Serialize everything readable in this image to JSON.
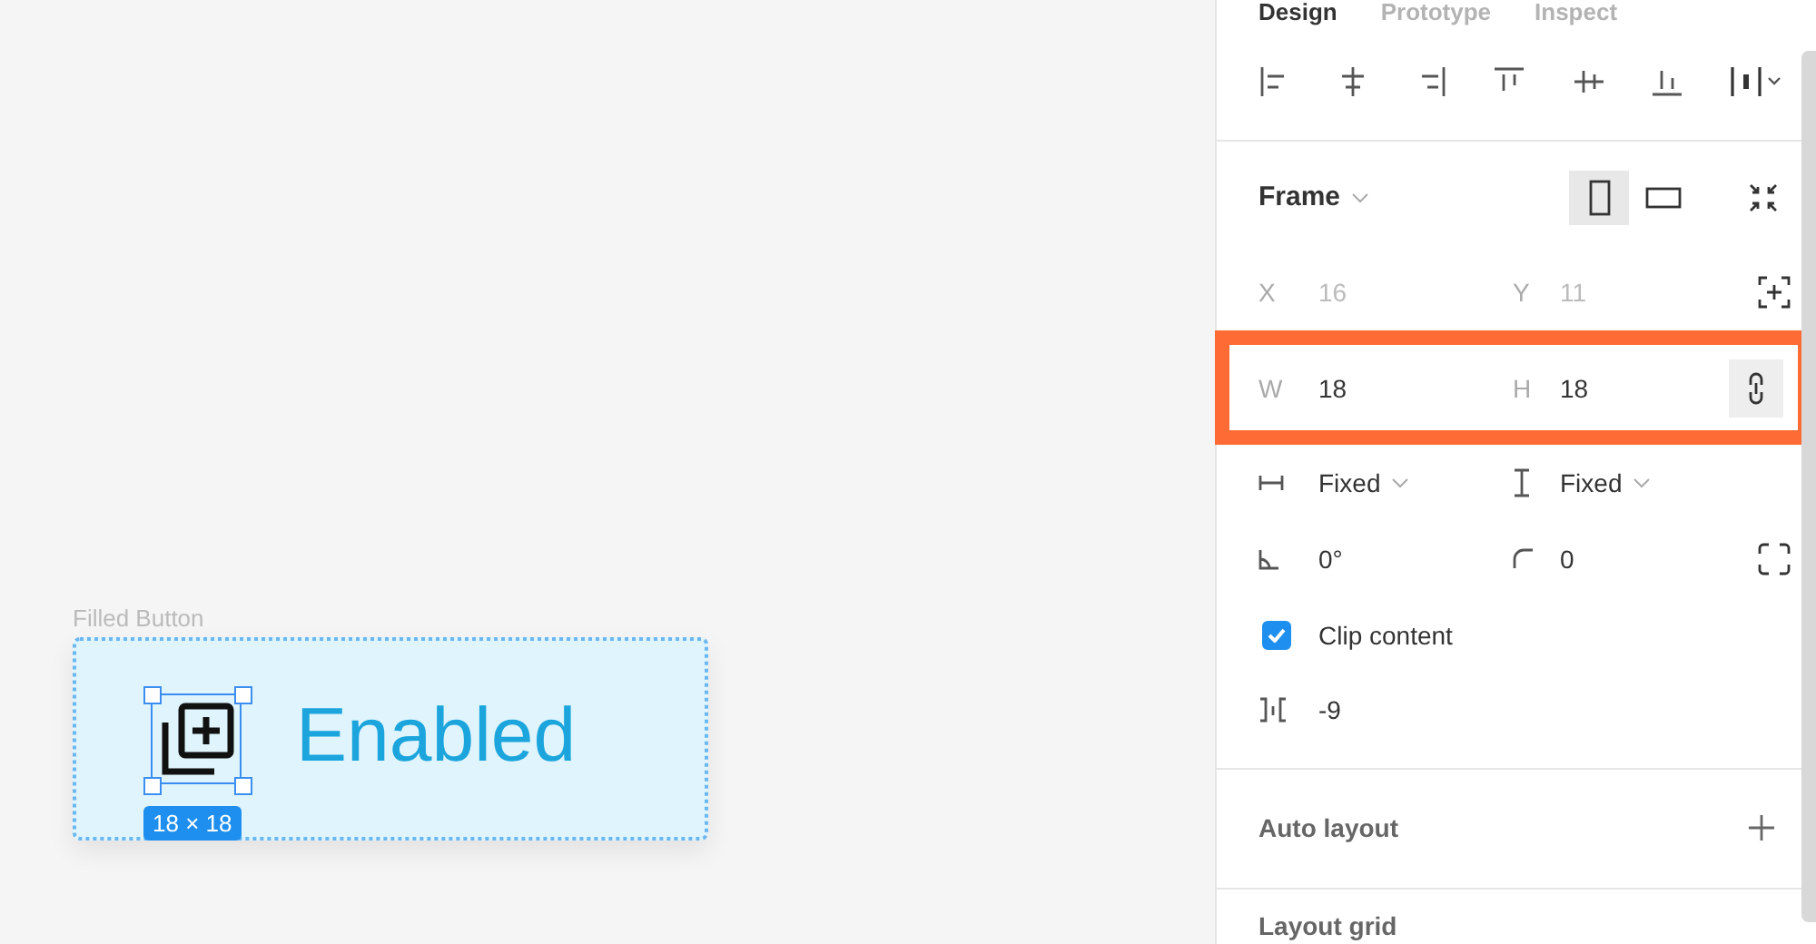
{
  "canvas": {
    "frame_label": "Filled Button",
    "button": {
      "label": "Enabled",
      "icon_selected": true,
      "size_badge": "18 × 18"
    }
  },
  "panel": {
    "tabs": [
      {
        "label": "Design",
        "selected": true
      },
      {
        "label": "Prototype",
        "selected": false
      },
      {
        "label": "Inspect",
        "selected": false
      }
    ],
    "frame": {
      "title": "Frame",
      "orientations": [
        {
          "kind": "portrait",
          "selected": true
        },
        {
          "kind": "landscape",
          "selected": false
        }
      ]
    },
    "position": {
      "x_label": "X",
      "x_value": "16",
      "y_label": "Y",
      "y_value": "11",
      "disabled": true
    },
    "size": {
      "w_label": "W",
      "w_value": "18",
      "h_label": "H",
      "h_value": "18",
      "highlighted": true
    },
    "constraints": {
      "horizontal": "Fixed",
      "vertical": "Fixed"
    },
    "rotation": "0°",
    "corner_radius": "0",
    "clip_content": {
      "label": "Clip content",
      "checked": true
    },
    "spacing": "-9",
    "sections": [
      {
        "title": "Auto layout"
      },
      {
        "title": "Layout grid"
      }
    ]
  }
}
